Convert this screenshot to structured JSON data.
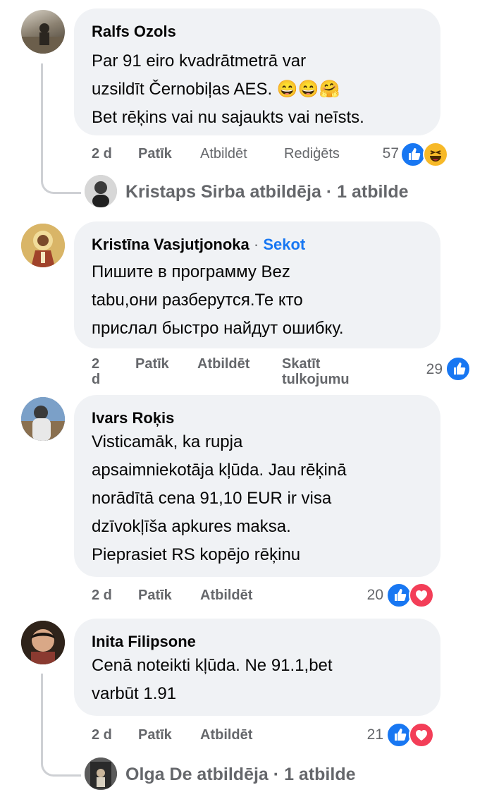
{
  "comments": [
    {
      "author": "Ralfs Ozols",
      "lines": [
        "Par 91 eiro kvadrātmetrā var",
        "uzsildīt Černobiļas AES. 😄😄🤗",
        "Bet rēķins vai nu sajaukts vai neīsts."
      ],
      "time": "2 d",
      "like": "Patīk",
      "reply": "Atbildēt",
      "extra": "Rediģēts",
      "reaction_count": "57",
      "reactions": [
        "like",
        "haha"
      ],
      "replies_summary": {
        "author": "Kristaps Sirba atbildēja",
        "sep": "·",
        "count": "1 atbilde"
      }
    },
    {
      "author": "Kristīna Vasjutjonoka",
      "sep": "·",
      "follow": "Sekot",
      "lines": [
        "Пишите в программу Bez",
        "tabu,они разберутся.Те кто",
        "прислал быстро найдут ошибку."
      ],
      "time_a": "2",
      "time_b": "d",
      "like": "Patīk",
      "reply": "Atbildēt",
      "extra_a": "Skatīt",
      "extra_b": "tulkojumu",
      "reaction_count": "29",
      "reactions": [
        "like"
      ]
    },
    {
      "author": "Ivars Roķis",
      "lines": [
        "Visticamāk, ka rupja",
        "apsaimniekotāja kļūda. Jau rēķinā",
        "norādītā cena 91,10 EUR ir visa",
        "dzīvokļīša apkures maksa.",
        "Pieprasiet RS kopējo rēķinu"
      ],
      "time": "2 d",
      "like": "Patīk",
      "reply": "Atbildēt",
      "reaction_count": "20",
      "reactions": [
        "like",
        "love"
      ]
    },
    {
      "author": "Inita Filipsone",
      "lines": [
        "Cenā noteikti kļūda. Ne 91.1,bet",
        "varbūt 1.91"
      ],
      "time": "2 d",
      "like": "Patīk",
      "reply": "Atbildēt",
      "reaction_count": "21",
      "reactions": [
        "like",
        "love"
      ],
      "replies_summary": {
        "author": "Olga De atbildēja",
        "sep": "·",
        "count": "1 atbilde"
      }
    }
  ],
  "icons": {
    "like": "thumbs-up-icon",
    "love": "heart-icon",
    "haha": "laughing-face-icon"
  },
  "colors": {
    "like": "#1877f2",
    "love": "#f33e58",
    "haha": "#f7b928",
    "link": "#1877f2",
    "meta": "#65676b",
    "bubble": "#f0f2f5"
  }
}
